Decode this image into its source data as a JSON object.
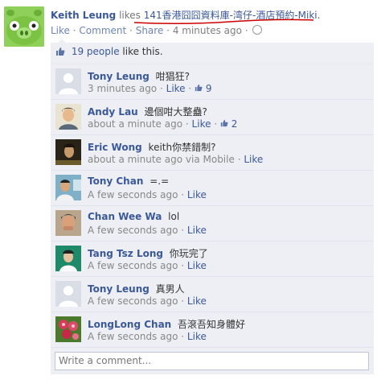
{
  "post": {
    "author": "Keith Leung",
    "verb": "likes",
    "page": "141香港囧囧資料庫-湾仔-酒店預約-Miki.",
    "actions": {
      "like": "Like",
      "comment": "Comment",
      "share": "Share"
    },
    "time": "4 minutes ago",
    "separator": "·"
  },
  "likes_summary": {
    "count_text": "19 people",
    "suffix": "like this."
  },
  "comments": [
    {
      "name": "Tony Leung",
      "text": "咁猖狂?",
      "time": "3 minutes ago",
      "like_label": "Like",
      "like_count": "9",
      "via": ""
    },
    {
      "name": "Andy Lau",
      "text": "邊個咁大整蠱?",
      "time": "about a minute ago",
      "like_label": "Like",
      "like_count": "2",
      "via": ""
    },
    {
      "name": "Eric Wong",
      "text": "keith你禁錯制?",
      "time": "about a minute ago",
      "like_label": "Like",
      "like_count": "",
      "via": "via Mobile"
    },
    {
      "name": "Tony Chan",
      "text": "=.=",
      "time": "A few seconds ago",
      "like_label": "Like",
      "like_count": "",
      "via": ""
    },
    {
      "name": "Chan Wee Wa",
      "text": "lol",
      "time": "A few seconds ago",
      "like_label": "Like",
      "like_count": "",
      "via": ""
    },
    {
      "name": "Tang Tsz Long",
      "text": "你玩完了",
      "time": "A few seconds ago",
      "like_label": "Like",
      "like_count": "",
      "via": ""
    },
    {
      "name": "Tony Leung",
      "text": "真男人",
      "time": "A few seconds ago",
      "like_label": "Like",
      "like_count": "",
      "via": ""
    },
    {
      "name": "LongLong Chan",
      "text": "吾滾吾知身體好",
      "time": "A few seconds ago",
      "like_label": "Like",
      "like_count": "",
      "via": ""
    }
  ],
  "write_comment": {
    "placeholder": "Write a comment..."
  },
  "colors": {
    "link": "#3b5998",
    "panel": "#edeff4",
    "annotation": "#cc0000"
  }
}
